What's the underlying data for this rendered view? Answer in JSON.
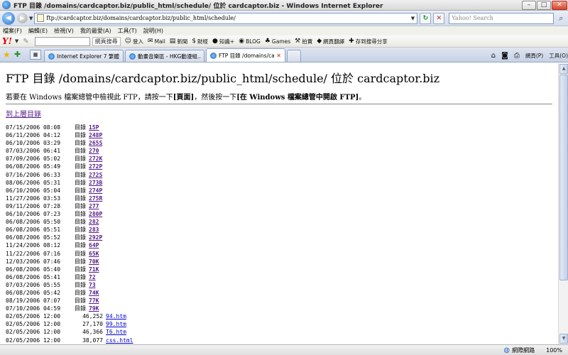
{
  "window": {
    "title": "FTP 目錄 /domains/cardcaptor.biz/public_html/schedule/ 位於 cardcaptor.biz - Windows Internet Explorer",
    "min": "–",
    "max": "□",
    "close": "✕"
  },
  "address": {
    "url": "ftp://cardcaptor.biz/domains/cardcaptor.biz/public_html/schedule/",
    "search_placeholder": "Yahoo! Search"
  },
  "menu": [
    "檔案(F)",
    "編輯(E)",
    "檢視(V)",
    "我的最愛(A)",
    "工具(T)",
    "說明(H)"
  ],
  "yahoo": {
    "logo": "Y!",
    "search_button": "網頁搜尋",
    "items": [
      "登入",
      "Mail",
      "新聞",
      "財經",
      "知識+",
      "BLOG",
      "Games",
      "拍賣",
      "網頁翻譯",
      "存到搜尋分享"
    ]
  },
  "tabs": [
    {
      "label": "Internet Explorer 7 繁體中文..."
    },
    {
      "label": "動畫音樂區 - HKG動漫組..."
    },
    {
      "label": "FTP 目錄 /domains/cardca..."
    }
  ],
  "tab_tools": {
    "page": "網頁(P)",
    "tools": "工具(O)"
  },
  "page": {
    "title": "FTP 目錄 /domains/cardcaptor.biz/public_html/schedule/ 位於 cardcaptor.biz",
    "desc_pre": "若要在 Windows 檔案總管中檢視此 FTP，請按一下",
    "desc_bold1": "[頁面]",
    "desc_mid": "，然後按一下",
    "desc_bold2": "[在 Windows 檔案總管中開啟 FTP]",
    "desc_end": "。",
    "up_link": "到上層目錄"
  },
  "listing": [
    {
      "date": "07/15/2006 08:08",
      "type": "目錄",
      "size": "",
      "name": "15P"
    },
    {
      "date": "06/11/2006 04:12",
      "type": "目錄",
      "size": "",
      "name": "248P"
    },
    {
      "date": "06/10/2006 03:29",
      "type": "目錄",
      "size": "",
      "name": "265S"
    },
    {
      "date": "07/03/2006 06:41",
      "type": "目錄",
      "size": "",
      "name": "270"
    },
    {
      "date": "07/09/2006 05:02",
      "type": "目錄",
      "size": "",
      "name": "272K"
    },
    {
      "date": "06/08/2006 05:49",
      "type": "目錄",
      "size": "",
      "name": "272P"
    },
    {
      "date": "07/16/2006 06:33",
      "type": "目錄",
      "size": "",
      "name": "272S"
    },
    {
      "date": "08/06/2006 05:31",
      "type": "目錄",
      "size": "",
      "name": "273B"
    },
    {
      "date": "06/10/2006 05:04",
      "type": "目錄",
      "size": "",
      "name": "274P"
    },
    {
      "date": "11/27/2006 03:53",
      "type": "目錄",
      "size": "",
      "name": "275R"
    },
    {
      "date": "09/11/2006 07:28",
      "type": "目錄",
      "size": "",
      "name": "277"
    },
    {
      "date": "06/10/2006 07:23",
      "type": "目錄",
      "size": "",
      "name": "280P"
    },
    {
      "date": "06/08/2006 05:50",
      "type": "目錄",
      "size": "",
      "name": "282"
    },
    {
      "date": "06/08/2006 05:51",
      "type": "目錄",
      "size": "",
      "name": "283"
    },
    {
      "date": "06/08/2006 05:52",
      "type": "目錄",
      "size": "",
      "name": "292P"
    },
    {
      "date": "11/24/2006 08:12",
      "type": "目錄",
      "size": "",
      "name": "64P"
    },
    {
      "date": "11/22/2006 07:16",
      "type": "目錄",
      "size": "",
      "name": "65K"
    },
    {
      "date": "12/03/2006 07:46",
      "type": "目錄",
      "size": "",
      "name": "70K"
    },
    {
      "date": "06/08/2006 05:40",
      "type": "目錄",
      "size": "",
      "name": "71K"
    },
    {
      "date": "06/08/2006 05:41",
      "type": "目錄",
      "size": "",
      "name": "72"
    },
    {
      "date": "07/03/2006 05:55",
      "type": "目錄",
      "size": "",
      "name": "73"
    },
    {
      "date": "06/08/2006 05:42",
      "type": "目錄",
      "size": "",
      "name": "74K"
    },
    {
      "date": "08/19/2006 07:07",
      "type": "目錄",
      "size": "",
      "name": "77K"
    },
    {
      "date": "07/10/2006 04:59",
      "type": "目錄",
      "size": "",
      "name": "79K"
    },
    {
      "date": "02/05/2006 12:00",
      "type": "",
      "size": "46,252",
      "name": "94.htm"
    },
    {
      "date": "02/05/2006 12:00",
      "type": "",
      "size": "27,170",
      "name": "99.htm"
    },
    {
      "date": "02/05/2006 12:00",
      "type": "",
      "size": "46,366",
      "name": "T6.htm"
    },
    {
      "date": "02/05/2006 12:00",
      "type": "",
      "size": "38,077",
      "name": "css.html"
    }
  ],
  "status": {
    "zone": "網際網路",
    "zoom": "100%"
  }
}
